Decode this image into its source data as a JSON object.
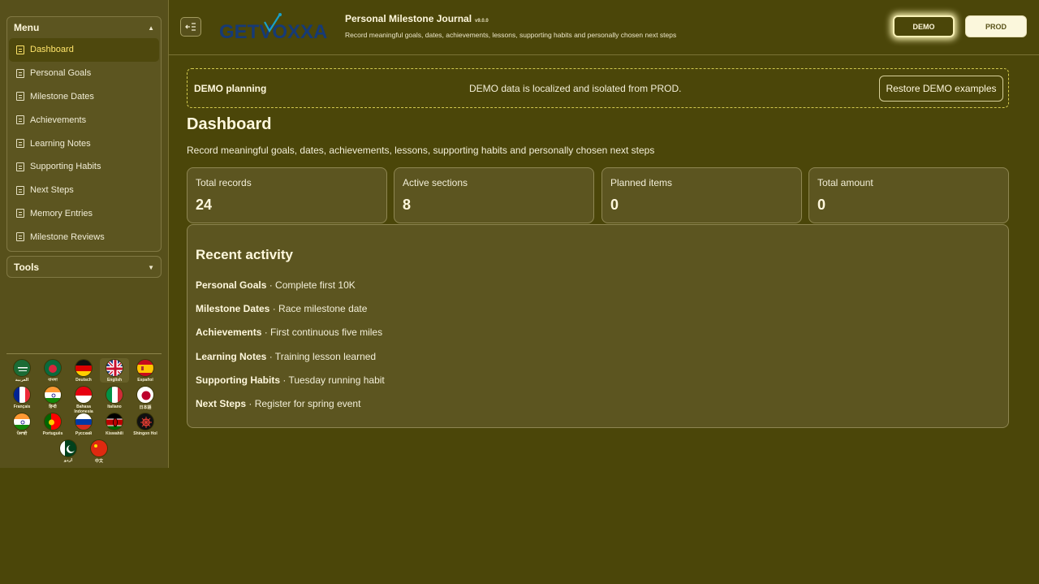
{
  "sidebar": {
    "menu_title": "Menu",
    "tools_title": "Tools",
    "items": [
      {
        "label": "Dashboard",
        "active": true
      },
      {
        "label": "Personal Goals"
      },
      {
        "label": "Milestone Dates"
      },
      {
        "label": "Achievements"
      },
      {
        "label": "Learning Notes"
      },
      {
        "label": "Supporting Habits"
      },
      {
        "label": "Next Steps"
      },
      {
        "label": "Memory Entries"
      },
      {
        "label": "Milestone Reviews"
      }
    ],
    "languages": [
      {
        "label": "العربية",
        "flag": "saudi-arabia-flag-icon"
      },
      {
        "label": "বাংলা",
        "flag": "bangladesh-flag-icon"
      },
      {
        "label": "Deutsch",
        "flag": "germany-flag-icon"
      },
      {
        "label": "English",
        "flag": "uk-flag-icon",
        "selected": true
      },
      {
        "label": "Español",
        "flag": "spain-flag-icon"
      },
      {
        "label": "Français",
        "flag": "france-flag-icon"
      },
      {
        "label": "हिन्दी",
        "flag": "india-flag-icon"
      },
      {
        "label": "Bahasa Indonesia",
        "flag": "indonesia-flag-icon"
      },
      {
        "label": "Italiano",
        "flag": "italy-flag-icon"
      },
      {
        "label": "日本語",
        "flag": "japan-flag-icon"
      },
      {
        "label": "ਪੰਜਾਬੀ",
        "flag": "india-flag-icon"
      },
      {
        "label": "Português",
        "flag": "portugal-flag-icon"
      },
      {
        "label": "Русский",
        "flag": "russia-flag-icon"
      },
      {
        "label": "Kiswahili",
        "flag": "kenya-flag-icon"
      },
      {
        "label": "Shingon Hol",
        "flag": "shingon-flag-icon"
      },
      {
        "label": "اردو",
        "flag": "pakistan-flag-icon"
      },
      {
        "label": "中文",
        "flag": "china-flag-icon"
      }
    ]
  },
  "header": {
    "logo_text": "GETVOXXA",
    "title": "Personal Milestone Journal",
    "version": "v9.0.0",
    "description": "Record meaningful goals, dates, achievements, lessons, supporting habits and personally chosen next steps",
    "demo_label": "DEMO",
    "prod_label": "PROD"
  },
  "notice": {
    "title": "DEMO planning",
    "text": "DEMO data is localized and isolated from PROD.",
    "restore_label": "Restore DEMO examples"
  },
  "main": {
    "title": "Dashboard",
    "subtitle": "Record meaningful goals, dates, achievements, lessons, supporting habits and personally chosen next steps",
    "stats": [
      {
        "label": "Total records",
        "value": "24"
      },
      {
        "label": "Active sections",
        "value": "8"
      },
      {
        "label": "Planned items",
        "value": "0"
      },
      {
        "label": "Total amount",
        "value": "0"
      }
    ],
    "activity_title": "Recent activity",
    "activity": [
      {
        "section": "Personal Goals",
        "text": " · Complete first 10K"
      },
      {
        "section": "Milestone Dates",
        "text": " · Race milestone date"
      },
      {
        "section": "Achievements",
        "text": " · First continuous five miles"
      },
      {
        "section": "Learning Notes",
        "text": " · Training lesson learned"
      },
      {
        "section": "Supporting Habits",
        "text": " · Tuesday running habit"
      },
      {
        "section": "Next Steps",
        "text": " · Register for spring event"
      }
    ]
  },
  "colors": {
    "background": "#4b4609",
    "panel": "#5c5520",
    "accent": "#ffe56a",
    "notice_border": "#d2c94f"
  }
}
